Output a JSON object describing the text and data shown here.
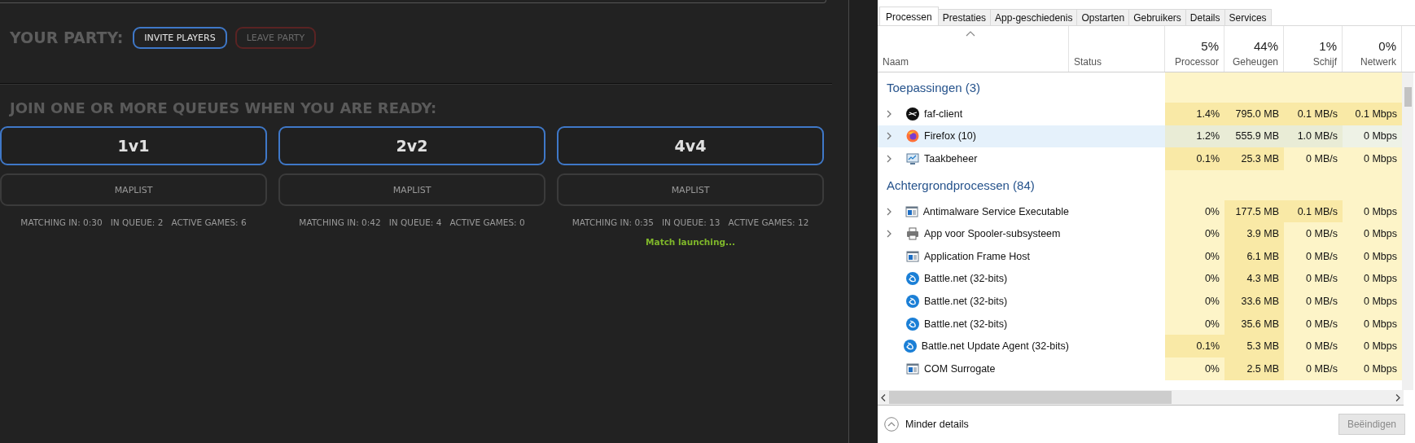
{
  "party": {
    "label": "YOUR PARTY:",
    "buttons": [
      {
        "label": "INVITE PLAYERS",
        "kind": "invite",
        "disabled": false
      },
      {
        "label": "LEAVE PARTY",
        "kind": "leave",
        "disabled": true
      }
    ]
  },
  "queues": {
    "heading": "JOIN ONE OR MORE QUEUES WHEN YOU ARE READY:",
    "items": [
      {
        "name": "1v1",
        "selected": true,
        "maplist": "MAPLIST",
        "stats": [
          "MATCHING IN: 0:30",
          "IN QUEUE: 2",
          "ACTIVE GAMES: 6"
        ]
      },
      {
        "name": "2v2",
        "selected": true,
        "maplist": "MAPLIST",
        "stats": [
          "MATCHING IN: 0:42",
          "IN QUEUE: 4",
          "ACTIVE GAMES: 0"
        ]
      },
      {
        "name": "4v4",
        "selected": true,
        "maplist": "MAPLIST",
        "stats": [
          "MATCHING IN: 0:35",
          "IN QUEUE: 13",
          "ACTIVE GAMES: 12"
        ],
        "status": "Match launching..."
      }
    ]
  },
  "task_manager": {
    "tabs": [
      {
        "label": "Processen",
        "selected": true
      },
      {
        "label": "Prestaties",
        "selected": false
      },
      {
        "label": "App-geschiedenis",
        "selected": false
      },
      {
        "label": "Opstarten",
        "selected": false
      },
      {
        "label": "Gebruikers",
        "selected": false
      },
      {
        "label": "Details",
        "selected": false
      },
      {
        "label": "Services",
        "selected": false
      }
    ],
    "columns": [
      {
        "label": "Naam",
        "sorted": true
      },
      {
        "label": "Status"
      },
      {
        "label": "Processor",
        "total": "5%"
      },
      {
        "label": "Geheugen",
        "total": "44%"
      },
      {
        "label": "Schijf",
        "total": "1%"
      },
      {
        "label": "Netwerk",
        "total": "0%"
      }
    ],
    "groups": [
      {
        "name": "Toepassingen (3)",
        "rows": [
          {
            "name": "faf-client",
            "kind": "faf",
            "expandable": true,
            "selected": false,
            "values": [
              {
                "text": "1.4%",
                "color": "#f9e9a6"
              },
              {
                "text": "795.0 MB",
                "color": "#f9e9a6"
              },
              {
                "text": "0.1 MB/s",
                "color": "#f9e9a6"
              },
              {
                "text": "0.1 Mbps",
                "color": "#f9e9a6"
              }
            ]
          },
          {
            "name": "Firefox (10)",
            "kind": "firefox",
            "expandable": true,
            "selected": true,
            "values": [
              {
                "text": "1.2%",
                "color": "#e9ecd6"
              },
              {
                "text": "555.9 MB",
                "color": "#e9ecd6"
              },
              {
                "text": "1.0 MB/s",
                "color": "#e9ecd6"
              },
              {
                "text": "0 Mbps",
                "color": "#eef2e6"
              }
            ]
          },
          {
            "name": "Taakbeheer",
            "kind": "monitor",
            "expandable": true,
            "selected": false,
            "values": [
              {
                "text": "0.1%",
                "color": "#f9e9a6"
              },
              {
                "text": "25.3 MB",
                "color": "#f9e9a6"
              },
              {
                "text": "0 MB/s",
                "color": "#fdf4c8"
              },
              {
                "text": "0 Mbps",
                "color": "#fdf4c8"
              }
            ]
          }
        ]
      },
      {
        "name": "Achtergrondprocessen (84)",
        "rows": [
          {
            "name": "Antimalware Service Executable",
            "kind": "window",
            "expandable": true,
            "selected": false,
            "values": [
              {
                "text": "0%",
                "color": "#fdf4c8"
              },
              {
                "text": "177.5 MB",
                "color": "#f9e9a6"
              },
              {
                "text": "0.1 MB/s",
                "color": "#f9e9a6"
              },
              {
                "text": "0 Mbps",
                "color": "#fdf4c8"
              }
            ]
          },
          {
            "name": "App voor Spooler-subsysteem",
            "kind": "printer",
            "expandable": true,
            "selected": false,
            "values": [
              {
                "text": "0%",
                "color": "#fdf4c8"
              },
              {
                "text": "3.9 MB",
                "color": "#f9e9a6"
              },
              {
                "text": "0 MB/s",
                "color": "#fdf4c8"
              },
              {
                "text": "0 Mbps",
                "color": "#fdf4c8"
              }
            ]
          },
          {
            "name": "Application Frame Host",
            "kind": "window",
            "expandable": false,
            "selected": false,
            "values": [
              {
                "text": "0%",
                "color": "#fdf4c8"
              },
              {
                "text": "6.1 MB",
                "color": "#f9e9a6"
              },
              {
                "text": "0 MB/s",
                "color": "#fdf4c8"
              },
              {
                "text": "0 Mbps",
                "color": "#fdf4c8"
              }
            ]
          },
          {
            "name": "Battle.net (32-bits)",
            "kind": "battlenet",
            "expandable": false,
            "selected": false,
            "values": [
              {
                "text": "0%",
                "color": "#fdf4c8"
              },
              {
                "text": "4.3 MB",
                "color": "#f9e9a6"
              },
              {
                "text": "0 MB/s",
                "color": "#fdf4c8"
              },
              {
                "text": "0 Mbps",
                "color": "#fdf4c8"
              }
            ]
          },
          {
            "name": "Battle.net (32-bits)",
            "kind": "battlenet",
            "expandable": false,
            "selected": false,
            "values": [
              {
                "text": "0%",
                "color": "#fdf4c8"
              },
              {
                "text": "33.6 MB",
                "color": "#f9e9a6"
              },
              {
                "text": "0 MB/s",
                "color": "#fdf4c8"
              },
              {
                "text": "0 Mbps",
                "color": "#fdf4c8"
              }
            ]
          },
          {
            "name": "Battle.net (32-bits)",
            "kind": "battlenet",
            "expandable": false,
            "selected": false,
            "values": [
              {
                "text": "0%",
                "color": "#fdf4c8"
              },
              {
                "text": "35.6 MB",
                "color": "#f9e9a6"
              },
              {
                "text": "0 MB/s",
                "color": "#fdf4c8"
              },
              {
                "text": "0 Mbps",
                "color": "#fdf4c8"
              }
            ]
          },
          {
            "name": "Battle.net Update Agent (32-bits)",
            "kind": "battlenet",
            "expandable": false,
            "selected": false,
            "values": [
              {
                "text": "0.1%",
                "color": "#f9e9a6"
              },
              {
                "text": "5.3 MB",
                "color": "#f9e9a6"
              },
              {
                "text": "0 MB/s",
                "color": "#fdf4c8"
              },
              {
                "text": "0 Mbps",
                "color": "#fdf4c8"
              }
            ]
          },
          {
            "name": "COM Surrogate",
            "kind": "window",
            "expandable": false,
            "selected": false,
            "values": [
              {
                "text": "0%",
                "color": "#fdf4c8"
              },
              {
                "text": "2.5 MB",
                "color": "#f9e9a6"
              },
              {
                "text": "0 MB/s",
                "color": "#fdf4c8"
              },
              {
                "text": "0 Mbps",
                "color": "#fdf4c8"
              }
            ]
          }
        ]
      }
    ],
    "footer": {
      "details": "Minder details",
      "end_button": {
        "label": "Beëindigen",
        "disabled": true
      }
    }
  }
}
